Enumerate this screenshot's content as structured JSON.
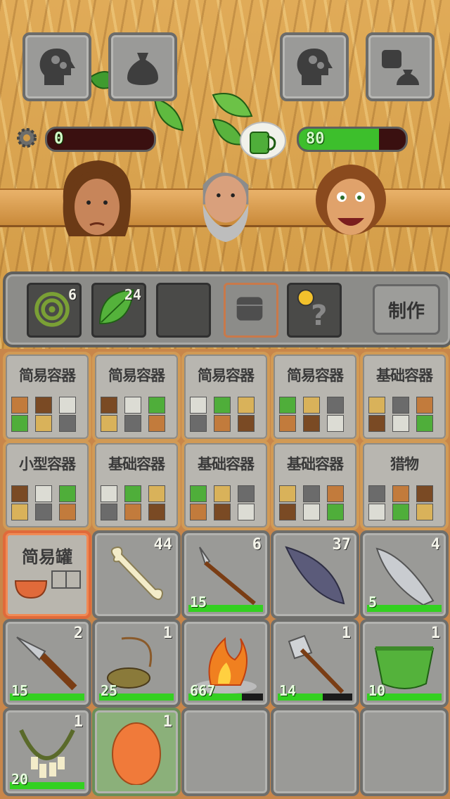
{
  "top_buttons": [
    {
      "name": "skills-head-icon"
    },
    {
      "name": "inventory-bag-icon"
    },
    {
      "name": "skills-head-icon-2"
    },
    {
      "name": "fist-bag-icon"
    }
  ],
  "status": {
    "left_bar_value": "0",
    "right_bar_value": "80",
    "left_fill": 0.0,
    "right_fill": 0.75
  },
  "craft_shelf": {
    "slots": [
      {
        "icon": "rope-coil-icon",
        "count": "6"
      },
      {
        "icon": "leaf-icon",
        "count": "24"
      },
      {
        "icon": "empty",
        "count": ""
      },
      {
        "icon": "fist-icon",
        "count": ""
      },
      {
        "icon": "hint-question-icon",
        "count": ""
      }
    ],
    "craft_label": "制作"
  },
  "recipes_row1": [
    "简易容器",
    "简易容器",
    "简易容器",
    "简易容器",
    "基础容器"
  ],
  "recipes_row2": [
    "小型容器",
    "基础容器",
    "基础容器",
    "基础容器",
    "猎物"
  ],
  "items": [
    {
      "label": "简易罐",
      "count": "",
      "durability": ""
    },
    {
      "icon": "bone-icon",
      "count": "44",
      "durability": ""
    },
    {
      "icon": "spear-icon",
      "count": "6",
      "durability": "15"
    },
    {
      "icon": "feather-icon",
      "count": "37",
      "durability": ""
    },
    {
      "icon": "stone-blade-icon",
      "count": "4",
      "durability": "5"
    },
    {
      "icon": "stone-knife-icon",
      "count": "2",
      "durability": "15"
    },
    {
      "icon": "sling-icon",
      "count": "1",
      "durability": "25"
    },
    {
      "icon": "campfire-icon",
      "count": "",
      "durability": "667"
    },
    {
      "icon": "stone-axe-icon",
      "count": "1",
      "durability": "14"
    },
    {
      "icon": "leaf-skirt-icon",
      "count": "1",
      "durability": "10"
    },
    {
      "icon": "bone-necklace-icon",
      "count": "1",
      "durability": "20"
    },
    {
      "icon": "egg-icon",
      "count": "1",
      "durability": ""
    }
  ],
  "item_fill": [
    1,
    1,
    1,
    1,
    1,
    1,
    1,
    0.72,
    0.6,
    1,
    1,
    1
  ],
  "colors": {
    "health": "#3dbf2c",
    "selected": "#e06a3a"
  }
}
